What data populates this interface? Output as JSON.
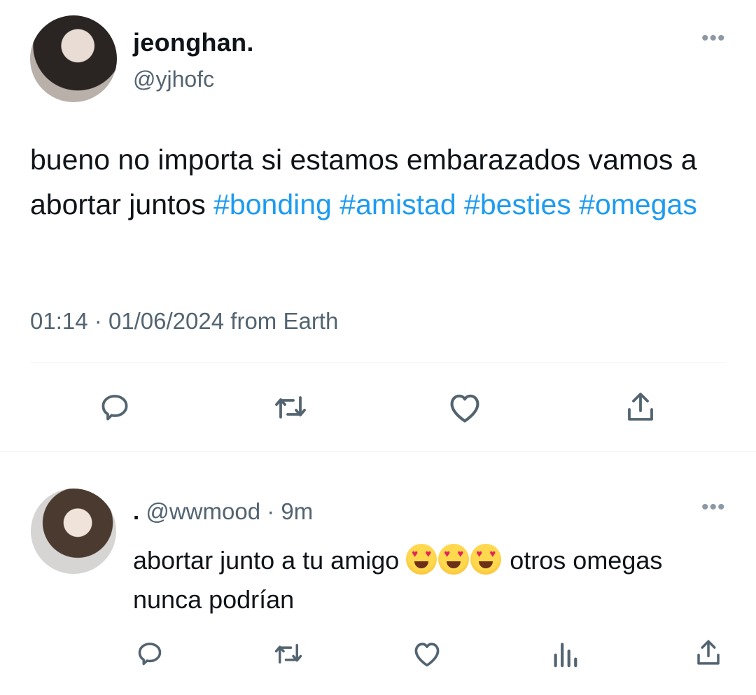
{
  "tweet": {
    "display_name": "jeonghan.",
    "handle": "@yjhofc",
    "text": "bueno no importa si estamos embarazados vamos a abortar juntos",
    "hashtags": [
      "#bonding",
      "#amistad",
      "#besties",
      "#omegas"
    ],
    "time": "01:14",
    "date": "01/06/2024",
    "source": "from Earth",
    "more": "•••"
  },
  "reply": {
    "display_name": ".",
    "handle": "@wwmood",
    "age": "9m",
    "text_before": "abortar junto a tu amigo",
    "text_after": "otros omegas nunca podrían",
    "emoji": "smiling-face-with-heart-eyes-emoji",
    "emoji_count": 3,
    "more": "•••"
  },
  "colors": {
    "hashtag": "#1d9bf0",
    "secondary_text": "#536471",
    "icon": "#536471"
  }
}
